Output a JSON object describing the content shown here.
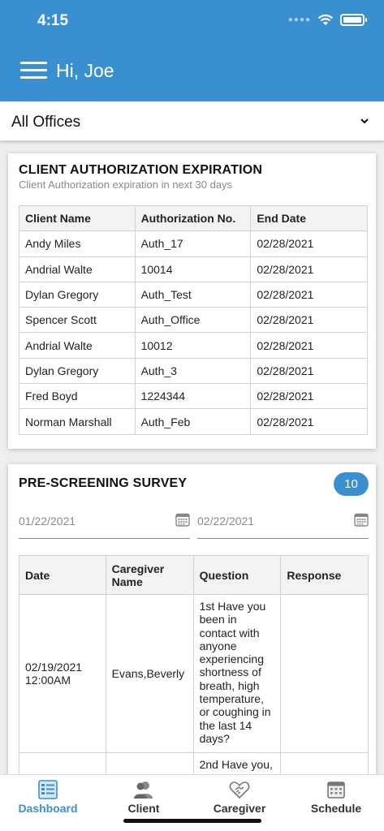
{
  "status_bar": {
    "time": "4:15"
  },
  "header": {
    "greeting": "Hi, Joe"
  },
  "office_select": {
    "value": "All Offices"
  },
  "authorization": {
    "title": "CLIENT AUTHORIZATION EXPIRATION",
    "subtitle": "Client Authorization expiration in next 30 days",
    "columns": [
      "Client Name",
      "Authorization No.",
      "End Date"
    ],
    "rows": [
      [
        "Andy Miles",
        "Auth_17",
        "02/28/2021"
      ],
      [
        "Andrial Walte",
        "10014",
        "02/28/2021"
      ],
      [
        "Dylan Gregory",
        "Auth_Test",
        "02/28/2021"
      ],
      [
        "Spencer Scott",
        "Auth_Office",
        "02/28/2021"
      ],
      [
        "Andrial Walte",
        "10012",
        "02/28/2021"
      ],
      [
        "Dylan Gregory",
        "Auth_3",
        "02/28/2021"
      ],
      [
        "Fred Boyd",
        "1224344",
        "02/28/2021"
      ],
      [
        "Norman Marshall",
        "Auth_Feb",
        "02/28/2021"
      ]
    ]
  },
  "survey": {
    "title": "PRE-SCREENING SURVEY",
    "count": "10",
    "date_from": "01/22/2021",
    "date_to": "02/22/2021",
    "columns": [
      "Date",
      "Caregiver Name",
      "Question",
      "Response"
    ],
    "rows": [
      [
        "02/19/2021 12:00AM",
        "Evans,Beverly",
        "1st Have you been in contact with anyone experiencing shortness of breath, high temperature, or coughing in the last 14 days?",
        ""
      ],
      [
        "",
        "",
        "2nd Have you,",
        ""
      ]
    ]
  },
  "nav": {
    "items": [
      {
        "label": "Dashboard",
        "icon": "dashboard-icon",
        "active": true
      },
      {
        "label": "Client",
        "icon": "client-icon",
        "active": false
      },
      {
        "label": "Caregiver",
        "icon": "caregiver-icon",
        "active": false
      },
      {
        "label": "Schedule",
        "icon": "schedule-icon",
        "active": false
      }
    ]
  },
  "colors": {
    "primary": "#3a8fd0",
    "header_bg": "#3a8fd0",
    "page_bg": "#efefef"
  }
}
